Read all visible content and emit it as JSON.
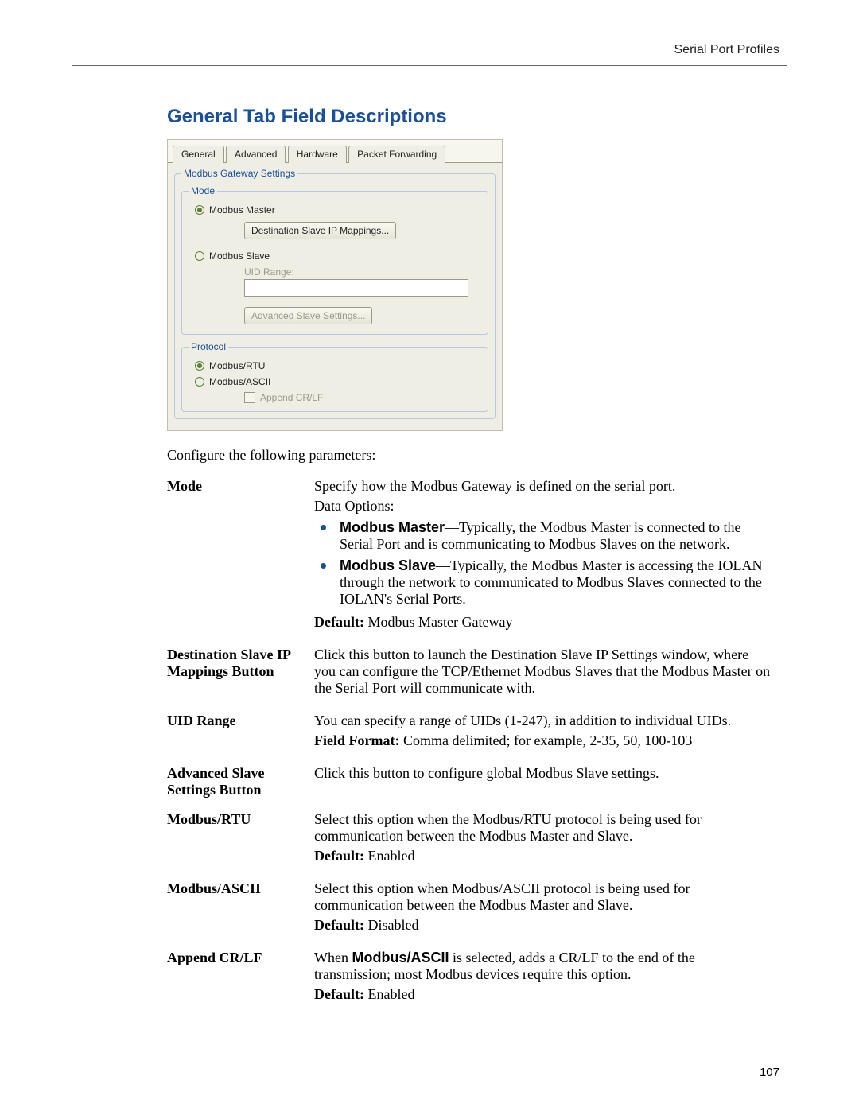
{
  "header": {
    "running_head": "Serial Port Profiles"
  },
  "title": "General Tab Field Descriptions",
  "dialog": {
    "tabs": [
      "General",
      "Advanced",
      "Hardware",
      "Packet Forwarding"
    ],
    "active_tab": 0,
    "group_modbus_gateway": "Modbus Gateway Settings",
    "group_mode": "Mode",
    "radio_master": "Modbus Master",
    "btn_dest_slave": "Destination Slave IP Mappings...",
    "radio_slave": "Modbus Slave",
    "uid_label": "UID Range:",
    "btn_adv_slave": "Advanced Slave Settings...",
    "group_protocol": "Protocol",
    "radio_rtu": "Modbus/RTU",
    "radio_ascii": "Modbus/ASCII",
    "chk_append": "Append CR/LF"
  },
  "intro": "Configure the following parameters:",
  "fields": [
    {
      "term": "Mode",
      "desc_lines": [
        "Specify how the Modbus Gateway is defined on the serial port.",
        "Data Options:"
      ],
      "options": [
        {
          "name": "Modbus Master",
          "text": "—Typically, the Modbus Master is connected to the Serial Port and is communicating to Modbus Slaves on the network."
        },
        {
          "name": "Modbus Slave",
          "text": "—Typically, the Modbus Master is accessing the IOLAN through the network to communicated to Modbus Slaves connected to the IOLAN's Serial Ports."
        }
      ],
      "default_label": "Default:",
      "default_value": "Modbus Master Gateway"
    },
    {
      "term": "Destination Slave IP Mappings Button",
      "desc_lines": [
        "Click this button to launch the Destination Slave IP Settings window, where you can configure the TCP/Ethernet Modbus Slaves that the Modbus Master on the Serial Port will communicate with."
      ]
    },
    {
      "term": "UID Range",
      "desc_lines": [
        "You can specify a range of UIDs (1-247), in addition to individual UIDs."
      ],
      "format_label": "Field Format:",
      "format_value": "Comma delimited; for example, 2-35, 50, 100-103"
    },
    {
      "term": "Advanced Slave Settings Button",
      "desc_lines": [
        "Click this button to configure global Modbus Slave settings."
      ]
    },
    {
      "term": "Modbus/RTU",
      "desc_lines": [
        "Select this option when the Modbus/RTU protocol is being used for communication between the Modbus Master and Slave."
      ],
      "default_label": "Default:",
      "default_value": "Enabled"
    },
    {
      "term": "Modbus/ASCII",
      "desc_lines": [
        "Select this option when Modbus/ASCII protocol is being used for communication between the Modbus Master and Slave."
      ],
      "default_label": "Default:",
      "default_value": "Disabled"
    },
    {
      "term": "Append CR/LF",
      "desc_html_prefix": "When ",
      "desc_html_bold": "Modbus/ASCII",
      "desc_html_suffix": " is selected, adds a CR/LF to the end of the transmission; most Modbus devices require this option.",
      "default_label": "Default:",
      "default_value": "Enabled"
    }
  ],
  "page_number": "107"
}
